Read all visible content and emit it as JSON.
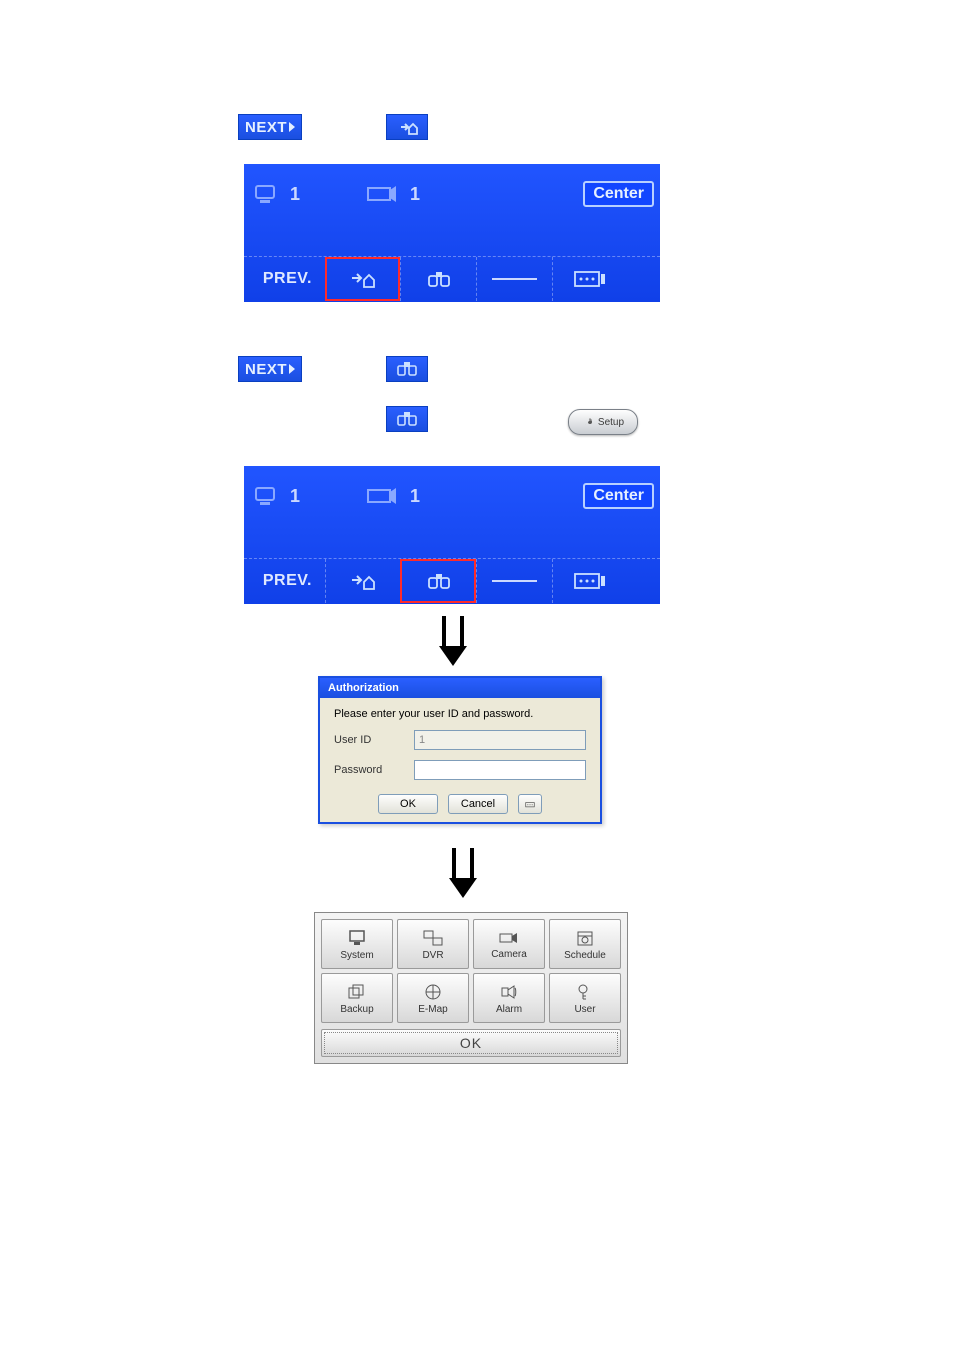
{
  "nav": {
    "next": "NEXT",
    "prev": "PREV."
  },
  "panelA": {
    "left_label": "1",
    "mid_label": "1",
    "right_tag": "Center"
  },
  "panelB": {
    "left_label": "1",
    "mid_label": "1",
    "right_tag": "Center"
  },
  "setup_btn": "Setup",
  "dialog": {
    "title": "Authorization",
    "prompt": "Please enter your user ID and password.",
    "user_id_label": "User ID",
    "user_id_value": "1",
    "password_label": "Password",
    "password_value": "",
    "ok": "OK",
    "cancel": "Cancel"
  },
  "settings": {
    "items": [
      "System",
      "DVR",
      "Camera",
      "Schedule",
      "Backup",
      "E-Map",
      "Alarm",
      "User"
    ],
    "ok": "OK"
  }
}
